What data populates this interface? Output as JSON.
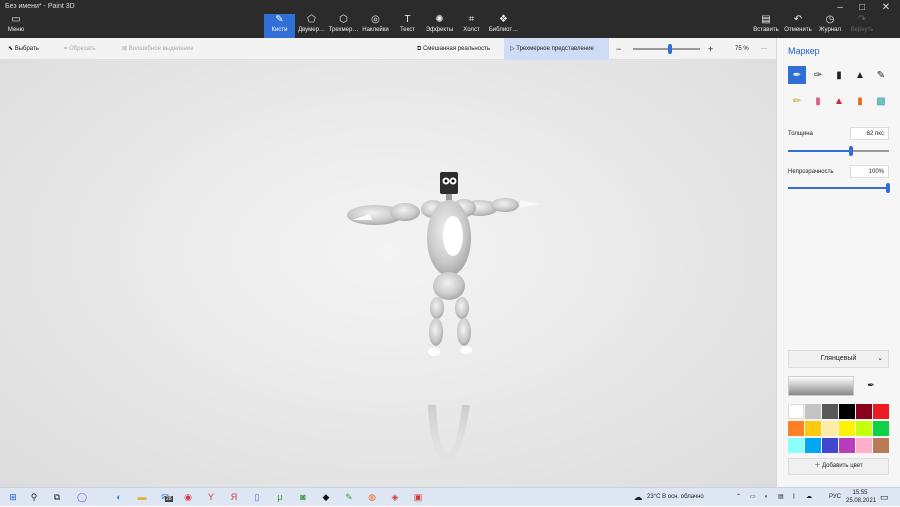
{
  "window": {
    "title": "Без имени* - Paint 3D"
  },
  "menu": {
    "label": "Меню"
  },
  "tabs": [
    {
      "label": "Кисти",
      "icon": "brush-icon"
    },
    {
      "label": "Двумер…",
      "icon": "2d-shapes-icon"
    },
    {
      "label": "Трехмер…",
      "icon": "3d-shapes-icon"
    },
    {
      "label": "Наклейки",
      "icon": "stickers-icon"
    },
    {
      "label": "Текст",
      "icon": "text-icon"
    },
    {
      "label": "Эффекты",
      "icon": "effects-icon"
    },
    {
      "label": "Холст",
      "icon": "canvas-icon"
    },
    {
      "label": "Библиот…",
      "icon": "library-icon"
    }
  ],
  "actions": {
    "paste": "Вставить",
    "undo": "Отменить",
    "history": "Журнал",
    "redo": "Вернуть"
  },
  "toolbar": {
    "select": "Выбрать",
    "crop": "Обрезать",
    "magic": "Волшебное выделение",
    "mixed": "Смешанная реальность",
    "view3d": "Трехмерное представление",
    "zoom": "75 %",
    "zoom_level": 0.55
  },
  "panel": {
    "title": "Маркер",
    "thickness_label": "Толщина",
    "thickness_value": "62 пкс",
    "thickness_level": 0.62,
    "opacity_label": "Непрозрачность",
    "opacity_value": "100%",
    "opacity_level": 1.0,
    "finish": "Глянцевый",
    "add_color": "Добавить цвет",
    "swatches": [
      "#ffffff",
      "#c3c3c3",
      "#585858",
      "#000000",
      "#88001b",
      "#ec1c24",
      "#ff7f27",
      "#ffc90e",
      "#fdeca6",
      "#fff200",
      "#c4ff0e",
      "#0ed145",
      "#8cfffb",
      "#00a8f3",
      "#3f48cc",
      "#b83dba",
      "#ffaec8",
      "#b97a56"
    ]
  },
  "taskbar": {
    "weather": "23°C  В осн. облачно",
    "lang": "РУС",
    "time": "15:55",
    "date": "25.08.2021",
    "badge": "28"
  }
}
